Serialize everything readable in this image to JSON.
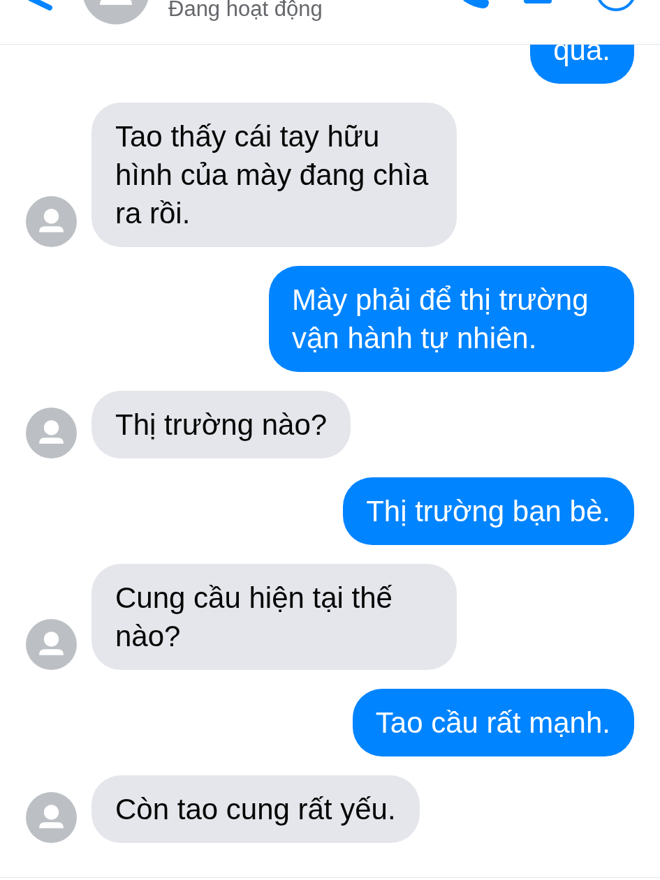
{
  "header": {
    "status": "Đang hoạt động"
  },
  "messages": [
    {
      "kind": "sent",
      "text": "qua."
    },
    {
      "kind": "received",
      "text": "Tao thấy cái tay hữu hình của mày đang chìa ra rồi."
    },
    {
      "kind": "sent",
      "text": "Mày phải để thị trường vận hành tự nhiên."
    },
    {
      "kind": "received",
      "text": "Thị trường nào?"
    },
    {
      "kind": "sent",
      "text": "Thị trường bạn bè."
    },
    {
      "kind": "received",
      "text": "Cung cầu hiện tại thế nào?"
    },
    {
      "kind": "sent",
      "text": "Tao cầu rất mạnh."
    },
    {
      "kind": "received",
      "text": "Còn tao cung rất yếu."
    }
  ]
}
